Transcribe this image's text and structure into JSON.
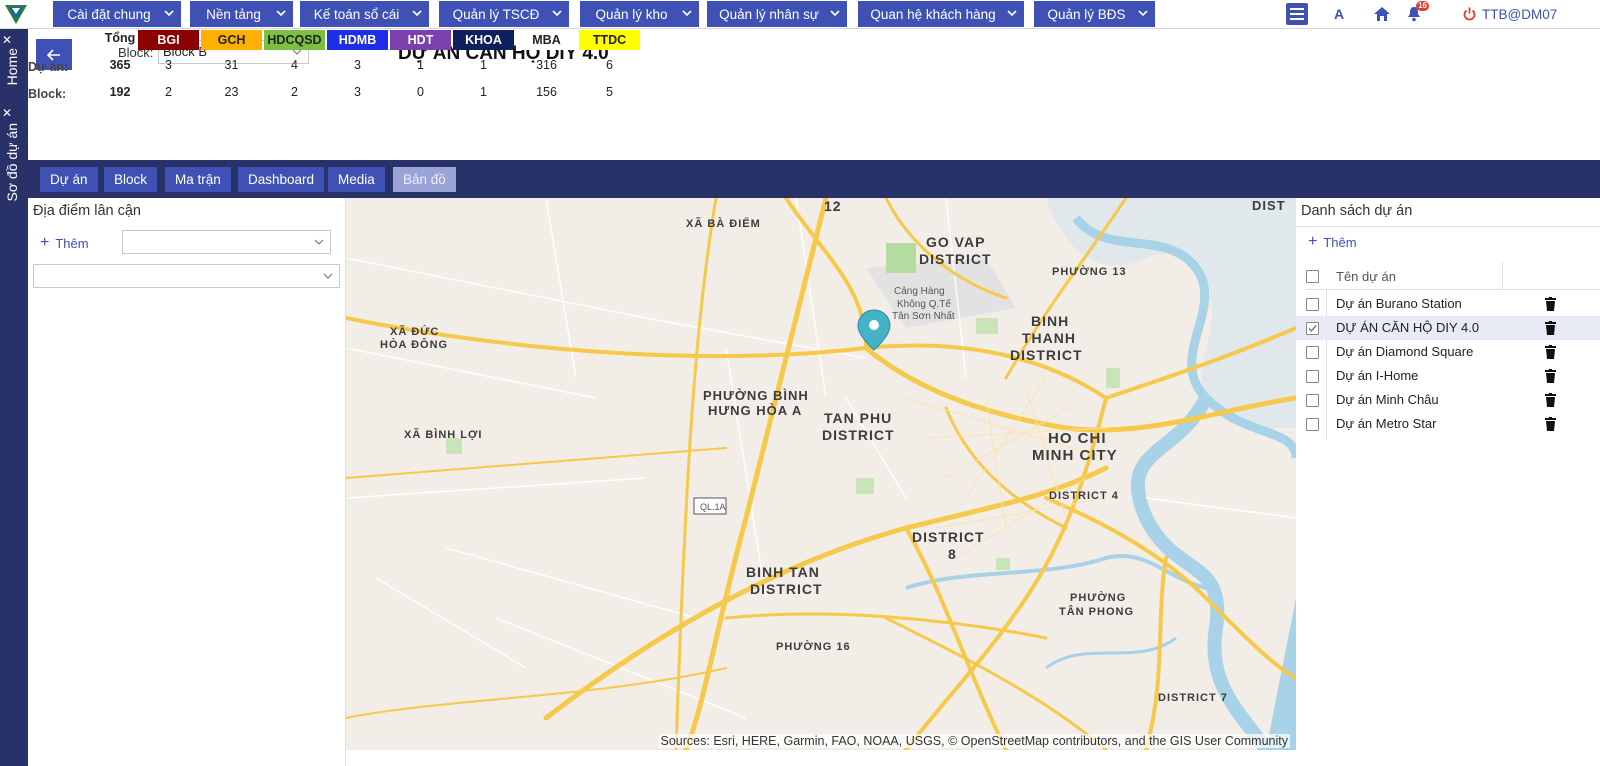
{
  "topnav": {
    "menus": [
      "Cài đặt chung",
      "Nền tảng",
      "Kế toán sổ cái",
      "Quản lý TSCĐ",
      "Quản lý kho",
      "Quản lý nhân sự",
      "Quan hệ khách hàng",
      "Quản lý BĐS"
    ],
    "font_btn": "A",
    "notification_count": "16",
    "user": "TTB@DM07"
  },
  "side_tabs": [
    "Home",
    "Sơ đồ dự án"
  ],
  "header": {
    "block_label": "Block:",
    "block_value": "Block B",
    "title": "DỰ ÁN CĂN HỘ DIY 4.0",
    "stats": {
      "total_label": "Tổng",
      "headers": [
        {
          "label": "BGI",
          "bg": "#8b0000",
          "fg": "#ffffff"
        },
        {
          "label": "GCH",
          "bg": "#ffb000",
          "fg": "#222222"
        },
        {
          "label": "HDCQSD",
          "bg": "#7cc042",
          "fg": "#222222"
        },
        {
          "label": "HDMB",
          "bg": "#1e2ee8",
          "fg": "#ffffff"
        },
        {
          "label": "HDT",
          "bg": "#7b3fae",
          "fg": "#ffffff"
        },
        {
          "label": "KHOA",
          "bg": "#0e1f5b",
          "fg": "#ffffff"
        },
        {
          "label": "MBA",
          "bg": "#ffffff",
          "fg": "#222222"
        },
        {
          "label": "TTDC",
          "bg": "#ffff00",
          "fg": "#222222"
        }
      ],
      "rows": [
        {
          "label": "Dự án:",
          "total": "365",
          "values": [
            "3",
            "31",
            "4",
            "3",
            "1",
            "1",
            "316",
            "6"
          ]
        },
        {
          "label": "Block:",
          "total": "192",
          "values": [
            "2",
            "23",
            "2",
            "3",
            "0",
            "1",
            "156",
            "5"
          ]
        }
      ]
    }
  },
  "tabs": [
    "Dự án",
    "Block",
    "Ma trận",
    "Dashboard",
    "Media",
    "Bản đồ"
  ],
  "active_tab": "Bản đồ",
  "left_panel": {
    "title": "Địa điểm lân cận",
    "add_label": "Thêm"
  },
  "map": {
    "labels": [
      "12",
      "XÃ BÀ ĐIỂM",
      "GO VAP",
      "DISTRICT",
      "PHƯỜNG 13",
      "Cảng Hàng",
      "Không Q.Tế",
      "Tân Sơn Nhất",
      "BINH",
      "THANH",
      "DISTRICT",
      "XÃ ĐỨC",
      "HÒA ĐÔNG",
      "PHƯỜNG BÌNH",
      "HƯNG HÒA A",
      "TAN PHU",
      "DISTRICT",
      "HO CHI",
      "MINH CITY",
      "XÃ BÌNH LỢI",
      "DISTRICT 4",
      "QL.1A",
      "DISTRICT",
      "8",
      "BINH TAN",
      "DISTRICT",
      "PHƯỜNG",
      "TÂN PHONG",
      "PHƯỜNG 16",
      "DISTRICT 7",
      "DIST"
    ],
    "attribution": "Sources: Esri, HERE, Garmin, FAO, NOAA, USGS, © OpenStreetMap contributors, and the GIS User Community"
  },
  "right_panel": {
    "title": "Danh sách dự án",
    "add_label": "Thêm",
    "column": "Tên dự án",
    "projects": [
      {
        "name": "Dự án Burano Station",
        "checked": false
      },
      {
        "name": "DỰ ÁN CĂN HỘ DIY 4.0",
        "checked": true
      },
      {
        "name": "Dự án Diamond Square",
        "checked": false
      },
      {
        "name": "Dự án I-Home",
        "checked": false
      },
      {
        "name": "Dự án Minh Châu",
        "checked": false
      },
      {
        "name": "Dự án Metro Star",
        "checked": false
      }
    ]
  },
  "colors": {
    "primary": "#3f51b5",
    "dark_nav": "#283268",
    "water": "#a7d2e8",
    "road": "#f6c94b"
  }
}
